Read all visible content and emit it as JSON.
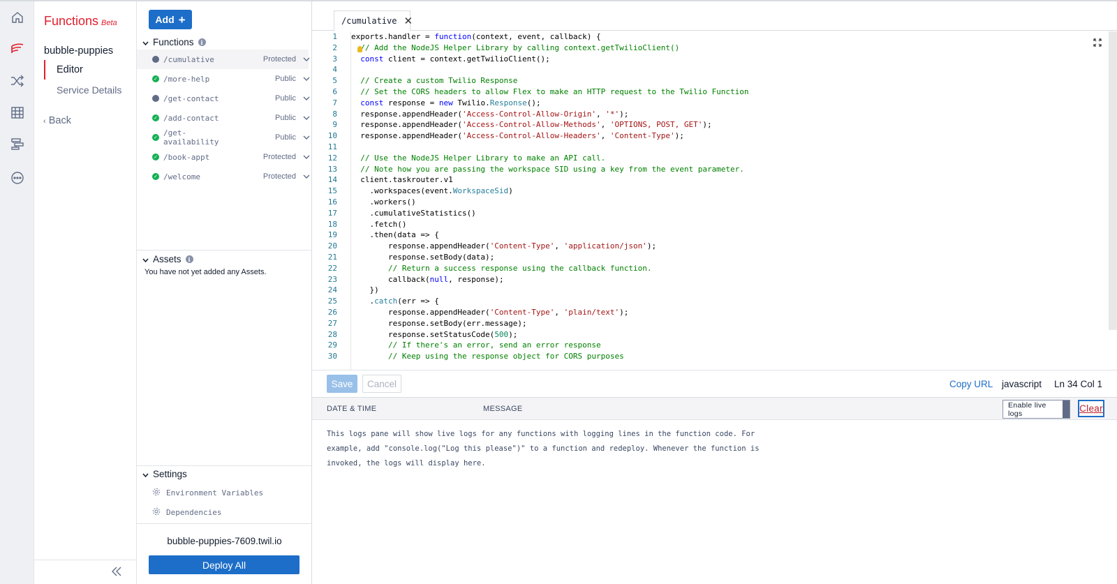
{
  "app": {
    "title": "Functions",
    "beta_label": "Beta",
    "service_name": "bubble-puppies",
    "nav": {
      "editor": "Editor",
      "service_details": "Service Details",
      "back": "Back"
    }
  },
  "rail_icons": [
    "home-icon",
    "functions-icon",
    "shuffle-icon",
    "studio-icon",
    "flow-icon",
    "more-icon"
  ],
  "file_panel": {
    "add_label": "Add",
    "functions_header": "Functions",
    "functions": [
      {
        "path": "/cumulative",
        "visibility": "Protected",
        "status": "unsaved"
      },
      {
        "path": "/more-help",
        "visibility": "Public",
        "status": "deployed"
      },
      {
        "path": "/get-contact",
        "visibility": "Public",
        "status": "unsaved"
      },
      {
        "path": "/add-contact",
        "visibility": "Public",
        "status": "deployed"
      },
      {
        "path": "/get-availability",
        "visibility": "Public",
        "status": "deployed"
      },
      {
        "path": "/book-appt",
        "visibility": "Protected",
        "status": "deployed"
      },
      {
        "path": "/welcome",
        "visibility": "Protected",
        "status": "deployed"
      }
    ],
    "assets_header": "Assets",
    "assets_empty": "You have not yet added any Assets.",
    "settings_header": "Settings",
    "settings_items": [
      "Environment Variables",
      "Dependencies"
    ],
    "domain": "bubble-puppies-7609.twil.io",
    "deploy_label": "Deploy All"
  },
  "editor": {
    "tab_label": "/cumulative",
    "code_lines": [
      "exports.handler = function(context, event, callback) {",
      "  // Add the NodeJS Helper Library by calling context.getTwilioClient()",
      "  const client = context.getTwilioClient();",
      "",
      "  // Create a custom Twilio Response",
      "  // Set the CORS headers to allow Flex to make an HTTP request to the Twilio Function",
      "  const response = new Twilio.Response();",
      "  response.appendHeader('Access-Control-Allow-Origin', '*');",
      "  response.appendHeader('Access-Control-Allow-Methods', 'OPTIONS, POST, GET');",
      "  response.appendHeader('Access-Control-Allow-Headers', 'Content-Type');",
      "",
      "  // Use the NodeJS Helper Library to make an API call.",
      "  // Note how you are passing the workspace SID using a key from the event parameter.",
      "  client.taskrouter.v1",
      "    .workspaces(event.WorkspaceSid)",
      "    .workers()",
      "    .cumulativeStatistics()",
      "    .fetch()",
      "    .then(data => {",
      "        response.appendHeader('Content-Type', 'application/json');",
      "        response.setBody(data);",
      "        // Return a success response using the callback function.",
      "        callback(null, response);",
      "    })",
      "    .catch(err => {",
      "        response.appendHeader('Content-Type', 'plain/text');",
      "        response.setBody(err.message);",
      "        response.setStatusCode(500);",
      "        // If there's an error, send an error response",
      "        // Keep using the response object for CORS purposes"
    ],
    "save_label": "Save",
    "cancel_label": "Cancel",
    "copy_url_label": "Copy URL",
    "language": "javascript",
    "cursor_position": "Ln 34  Col 1"
  },
  "logs": {
    "col_datetime": "DATE & TIME",
    "col_message": "MESSAGE",
    "live_logs_label": "Enable live logs",
    "clear_label": "Clear",
    "empty_message": "This logs pane will show live logs for any functions with logging lines in the function code. For example, add \"console.log(\"Log this please\")\" to a function and redeploy. Whenever the function is invoked, the logs will display here."
  },
  "colors": {
    "brand_red": "#e31e2d",
    "primary_blue": "#1d6ec8",
    "status_green": "#14b053"
  }
}
